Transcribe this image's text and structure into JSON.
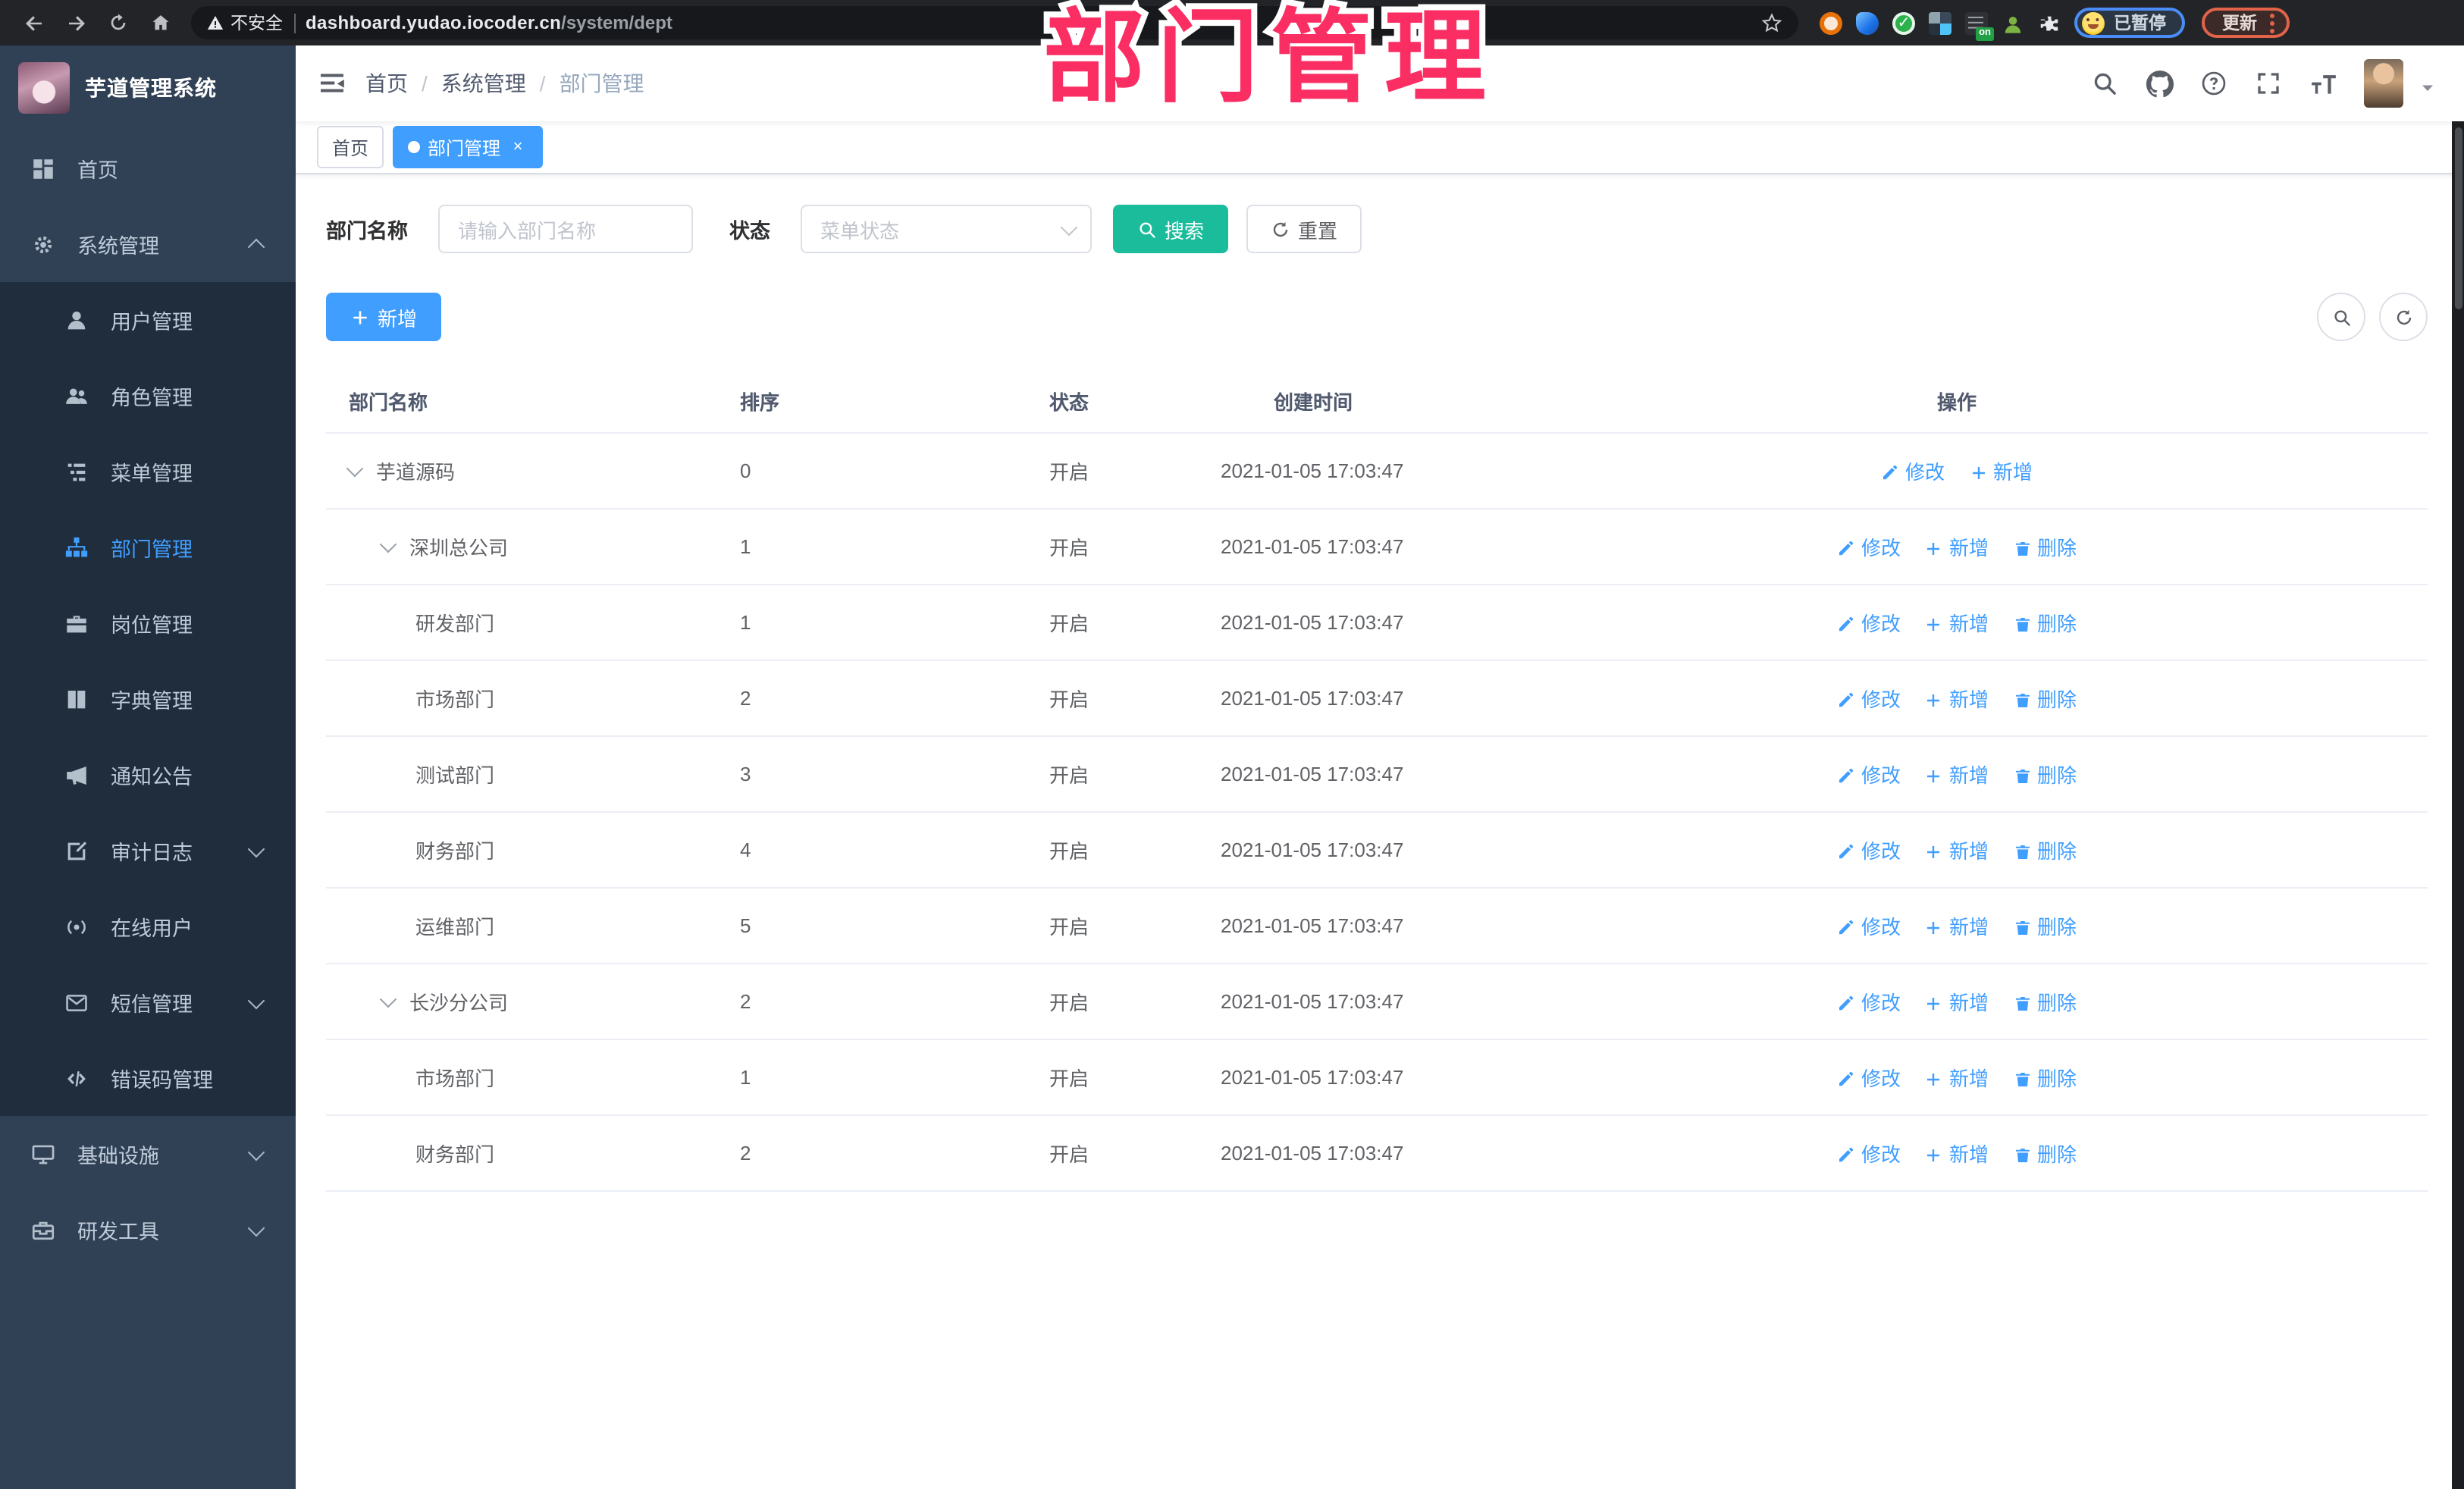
{
  "colors": {
    "accent": "#409eff",
    "search_button": "#1abc9c",
    "overlay_pink": "#fb2e63",
    "sidebar_bg": "#304156",
    "submenu_bg": "#1f2d3d"
  },
  "browser": {
    "security_label": "不安全",
    "url_host": "dashboard.yudao.iocoder.cn",
    "url_path": "/system/dept",
    "extension_badge": "on",
    "paused_label": "已暂停",
    "update_label": "更新"
  },
  "overlay_title": "部门管理",
  "sidebar": {
    "logo_title": "芋道管理系统",
    "items": [
      {
        "label": "首页",
        "icon": "dashboard",
        "level": "top",
        "chevron": null,
        "active": false
      },
      {
        "label": "系统管理",
        "icon": "gear",
        "level": "top",
        "chevron": "up",
        "active": false
      },
      {
        "label": "用户管理",
        "icon": "user",
        "level": "sub",
        "chevron": null,
        "active": false
      },
      {
        "label": "角色管理",
        "icon": "users",
        "level": "sub",
        "chevron": null,
        "active": false
      },
      {
        "label": "菜单管理",
        "icon": "menu",
        "level": "sub",
        "chevron": null,
        "active": false
      },
      {
        "label": "部门管理",
        "icon": "tree",
        "level": "sub",
        "chevron": null,
        "active": true
      },
      {
        "label": "岗位管理",
        "icon": "briefcase",
        "level": "sub",
        "chevron": null,
        "active": false
      },
      {
        "label": "字典管理",
        "icon": "book",
        "level": "sub",
        "chevron": null,
        "active": false
      },
      {
        "label": "通知公告",
        "icon": "megaphone",
        "level": "sub",
        "chevron": null,
        "active": false
      },
      {
        "label": "审计日志",
        "icon": "edit",
        "level": "sub",
        "chevron": "down",
        "active": false
      },
      {
        "label": "在线用户",
        "icon": "online",
        "level": "sub",
        "chevron": null,
        "active": false
      },
      {
        "label": "短信管理",
        "icon": "message",
        "level": "sub",
        "chevron": "down",
        "active": false
      },
      {
        "label": "错误码管理",
        "icon": "code",
        "level": "sub",
        "chevron": null,
        "active": false
      },
      {
        "label": "基础设施",
        "icon": "monitor",
        "level": "top",
        "chevron": "down",
        "active": false
      },
      {
        "label": "研发工具",
        "icon": "toolbox",
        "level": "top",
        "chevron": "down",
        "active": false
      }
    ]
  },
  "header": {
    "breadcrumb": [
      "首页",
      "系统管理",
      "部门管理"
    ]
  },
  "tags": [
    {
      "label": "首页",
      "active": false,
      "closable": false
    },
    {
      "label": "部门管理",
      "active": true,
      "closable": true
    }
  ],
  "filters": {
    "name_label": "部门名称",
    "name_placeholder": "请输入部门名称",
    "status_label": "状态",
    "status_placeholder": "菜单状态",
    "search_label": "搜索",
    "reset_label": "重置"
  },
  "toolbar": {
    "add_label": "新增"
  },
  "table": {
    "columns": [
      "部门名称",
      "排序",
      "状态",
      "创建时间",
      "操作"
    ],
    "action_labels": {
      "edit": "修改",
      "add": "新增",
      "delete": "删除"
    },
    "rows": [
      {
        "name": "芋道源码",
        "indent": 0,
        "expandable": true,
        "sort": "0",
        "status": "开启",
        "created": "2021-01-05 17:03:47",
        "actions": [
          "edit",
          "add"
        ]
      },
      {
        "name": "深圳总公司",
        "indent": 1,
        "expandable": true,
        "sort": "1",
        "status": "开启",
        "created": "2021-01-05 17:03:47",
        "actions": [
          "edit",
          "add",
          "delete"
        ]
      },
      {
        "name": "研发部门",
        "indent": 2,
        "expandable": false,
        "sort": "1",
        "status": "开启",
        "created": "2021-01-05 17:03:47",
        "actions": [
          "edit",
          "add",
          "delete"
        ]
      },
      {
        "name": "市场部门",
        "indent": 2,
        "expandable": false,
        "sort": "2",
        "status": "开启",
        "created": "2021-01-05 17:03:47",
        "actions": [
          "edit",
          "add",
          "delete"
        ]
      },
      {
        "name": "测试部门",
        "indent": 2,
        "expandable": false,
        "sort": "3",
        "status": "开启",
        "created": "2021-01-05 17:03:47",
        "actions": [
          "edit",
          "add",
          "delete"
        ]
      },
      {
        "name": "财务部门",
        "indent": 2,
        "expandable": false,
        "sort": "4",
        "status": "开启",
        "created": "2021-01-05 17:03:47",
        "actions": [
          "edit",
          "add",
          "delete"
        ]
      },
      {
        "name": "运维部门",
        "indent": 2,
        "expandable": false,
        "sort": "5",
        "status": "开启",
        "created": "2021-01-05 17:03:47",
        "actions": [
          "edit",
          "add",
          "delete"
        ]
      },
      {
        "name": "长沙分公司",
        "indent": 1,
        "expandable": true,
        "sort": "2",
        "status": "开启",
        "created": "2021-01-05 17:03:47",
        "actions": [
          "edit",
          "add",
          "delete"
        ]
      },
      {
        "name": "市场部门",
        "indent": 2,
        "expandable": false,
        "sort": "1",
        "status": "开启",
        "created": "2021-01-05 17:03:47",
        "actions": [
          "edit",
          "add",
          "delete"
        ]
      },
      {
        "name": "财务部门",
        "indent": 2,
        "expandable": false,
        "sort": "2",
        "status": "开启",
        "created": "2021-01-05 17:03:47",
        "actions": [
          "edit",
          "add",
          "delete"
        ]
      }
    ]
  }
}
